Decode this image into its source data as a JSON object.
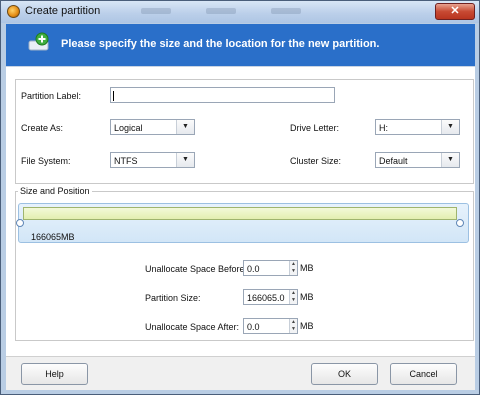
{
  "window": {
    "title": "Create partition",
    "close_glyph": "✕"
  },
  "header": {
    "text": "Please specify the size and the location for the new partition.",
    "icon": "add-disk-icon"
  },
  "fields": {
    "partition_label": {
      "label": "Partition Label:",
      "value": ""
    },
    "create_as": {
      "label": "Create As:",
      "value": "Logical"
    },
    "drive_letter": {
      "label": "Drive Letter:",
      "value": "H:"
    },
    "file_system": {
      "label": "File System:",
      "value": "NTFS"
    },
    "cluster_size": {
      "label": "Cluster Size:",
      "value": "Default"
    }
  },
  "size_position": {
    "title": "Size and Position",
    "partition_size_display": "166065MB",
    "unallocated_before": {
      "label": "Unallocate Space Before:",
      "value": "0.0",
      "unit": "MB"
    },
    "partition_size": {
      "label": "Partition Size:",
      "value": "166065.0",
      "unit": "MB"
    },
    "unallocated_after": {
      "label": "Unallocate Space After:",
      "value": "0.0",
      "unit": "MB"
    }
  },
  "buttons": {
    "help": "Help",
    "ok": "OK",
    "cancel": "Cancel"
  },
  "colors": {
    "header_blue": "#2a6fc9",
    "partition_fill": "#e3efb0"
  }
}
